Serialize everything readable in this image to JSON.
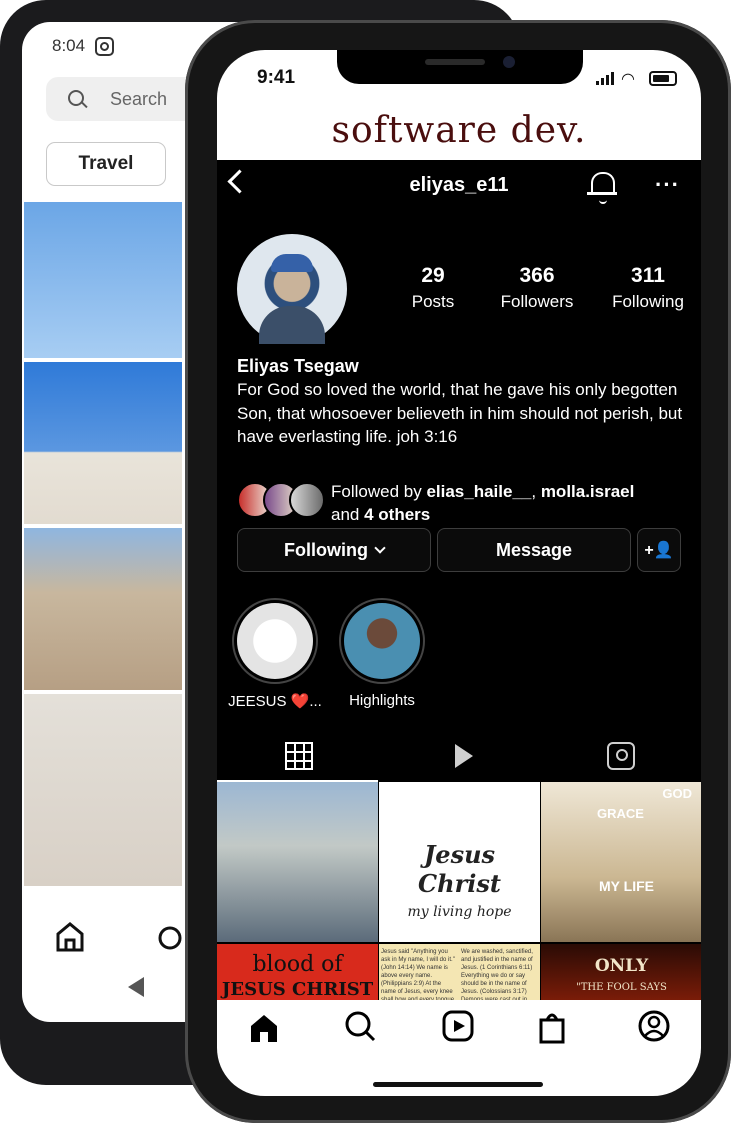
{
  "back_phone": {
    "time": "8:04",
    "search_placeholder": "Search",
    "chip_label": "Travel"
  },
  "status": {
    "time": "9:41"
  },
  "banner": {
    "text": "software dev."
  },
  "header": {
    "username": "eliyas_e11",
    "more_label": "···"
  },
  "profile": {
    "stats": [
      {
        "value": "29",
        "label": "Posts"
      },
      {
        "value": "366",
        "label": "Followers"
      },
      {
        "value": "311",
        "label": "Following"
      }
    ],
    "name": "Eliyas Tsegaw",
    "bio": "For God so loved the world, that he gave his only begotten Son, that whosoever believeth in him should not perish, but have everlasting life. joh 3:16",
    "followed_by_prefix": "Followed by ",
    "followed_by_user1": "elias_haile__",
    "followed_by_sep": ", ",
    "followed_by_user2": "molla.israel",
    "followed_by_and": "and ",
    "followed_by_others": "4 others"
  },
  "actions": {
    "following": "Following",
    "message": "Message",
    "add_user": "+👤"
  },
  "highlights": [
    {
      "label": "JEESUS ❤️..."
    },
    {
      "label": "Highlights"
    }
  ],
  "posts": {
    "jesus_title": "Jesus Christ",
    "jesus_subtitle": "my living hope",
    "meme_god": "GOD",
    "meme_grace": "GRACE",
    "meme_life": "MY LIFE",
    "blood_line1": "blood of",
    "blood_line2": "JESUS CHRIST",
    "verses_left": "Jesus said \"Anything you ask in My name, I will do it.\" (John 14:14) We name is above every name. (Philippians 2:9) At the name of Jesus, every knee shall bow and every tongue confess that He is Lord.",
    "verses_right": "We are washed, sanctified, and justified in the name of Jesus. (1 Corinthians 6:11) Everything we do or say should be in the name of Jesus. (Colossians 3:17) Demons were cast out in the name of Jesus.",
    "only_title": "ONLY",
    "only_sub": "\"THE FOOL SAYS"
  },
  "colors": {
    "banner_text": "#4a0e0e",
    "screen_bg": "#000000",
    "button_border": "#3d3d3d"
  },
  "icons": [
    "back-chevron-icon",
    "bell-icon",
    "more-icon",
    "grid-icon",
    "reels-icon",
    "tagged-icon",
    "home-icon",
    "search-icon",
    "reels-nav-icon",
    "shop-icon",
    "profile-icon"
  ]
}
